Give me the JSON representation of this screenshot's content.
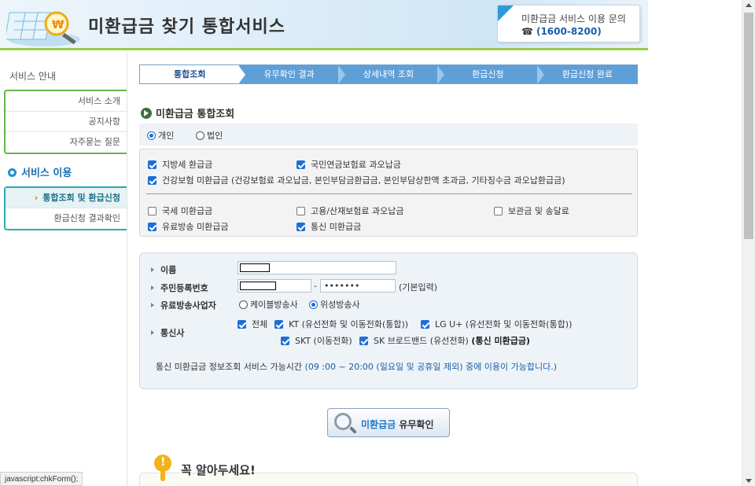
{
  "header": {
    "title": "미환급금 찾기 통합서비스",
    "contact_title": "미환급금 서비스 이용 문의",
    "contact_phone_icon": "☎",
    "contact_phone": "(1600-8200)"
  },
  "sidebar": {
    "guide_title": "서비스 안내",
    "guide_items": [
      "서비스 소개",
      "공지사항",
      "자주묻는 질문"
    ],
    "use_title": "서비스 이용",
    "use_items": [
      {
        "label": "통합조회 및 환급신청",
        "active": true
      },
      {
        "label": "환급신청 결과확인",
        "active": false
      }
    ]
  },
  "steps": [
    "통합조회",
    "유무확인 결과",
    "상세내역 조회",
    "환급신청",
    "환급신청 완료"
  ],
  "section_title": "미환급금 통합조회",
  "type_options": [
    {
      "label": "개인",
      "checked": true
    },
    {
      "label": "법인",
      "checked": false
    }
  ],
  "checks": {
    "local_tax": {
      "label": "지방세 환급금",
      "checked": true
    },
    "pension": {
      "label": "국민연금보험료 과오납금",
      "checked": true
    },
    "health": {
      "label": "건강보험 미환급금 (건강보험료 과오납금, 본인부담금환급금, 본인부담상한액 초과금, 기타징수금 과오납환급금)",
      "checked": true
    },
    "national_tax": {
      "label": "국세 미환급금",
      "checked": false
    },
    "employment": {
      "label": "고용/산재보험료 과오납금",
      "checked": false
    },
    "deposit": {
      "label": "보관금 및 송달료",
      "checked": false
    },
    "broadcast": {
      "label": "유료방송 미환급금",
      "checked": true
    },
    "telecom": {
      "label": "통신 미환급금",
      "checked": true
    }
  },
  "form": {
    "name_label": "이름",
    "rrn_label": "주민등록번호",
    "rrn_dash": "-",
    "rrn_back_value": "•••••••",
    "rrn_hint": "(기본입력)",
    "broadcaster_label": "유료방송사업자",
    "broadcaster_options": [
      {
        "label": "케이블방송사",
        "checked": false
      },
      {
        "label": "위성방송사",
        "checked": true
      }
    ],
    "telecom_label": "통신사",
    "telecom_options": [
      {
        "label": "전체",
        "checked": true
      },
      {
        "label": "KT (유선전화 및 이동전화(통합))",
        "checked": true
      },
      {
        "label": "LG U+ (유선전화 및 이동전화(통합))",
        "checked": true
      },
      {
        "label": "SKT (이동전화)",
        "checked": true
      },
      {
        "label": "SK 브로드밴드 (유선전화)",
        "checked": true
      }
    ],
    "telecom_note": "(통신 미환급금)",
    "notice_prefix": "통신 미환급금 정보조회 서비스 가능시간",
    "notice_time": "(09 :00 ~ 20:00 (일요일 및 공휴일 제외) 중에 이용이 가능합니다.)"
  },
  "search_button": {
    "highlight": "미환급금",
    "rest": " 유무확인"
  },
  "must_know": "꼭 알아두세요!",
  "status_bar": "javascript:chkForm();"
}
